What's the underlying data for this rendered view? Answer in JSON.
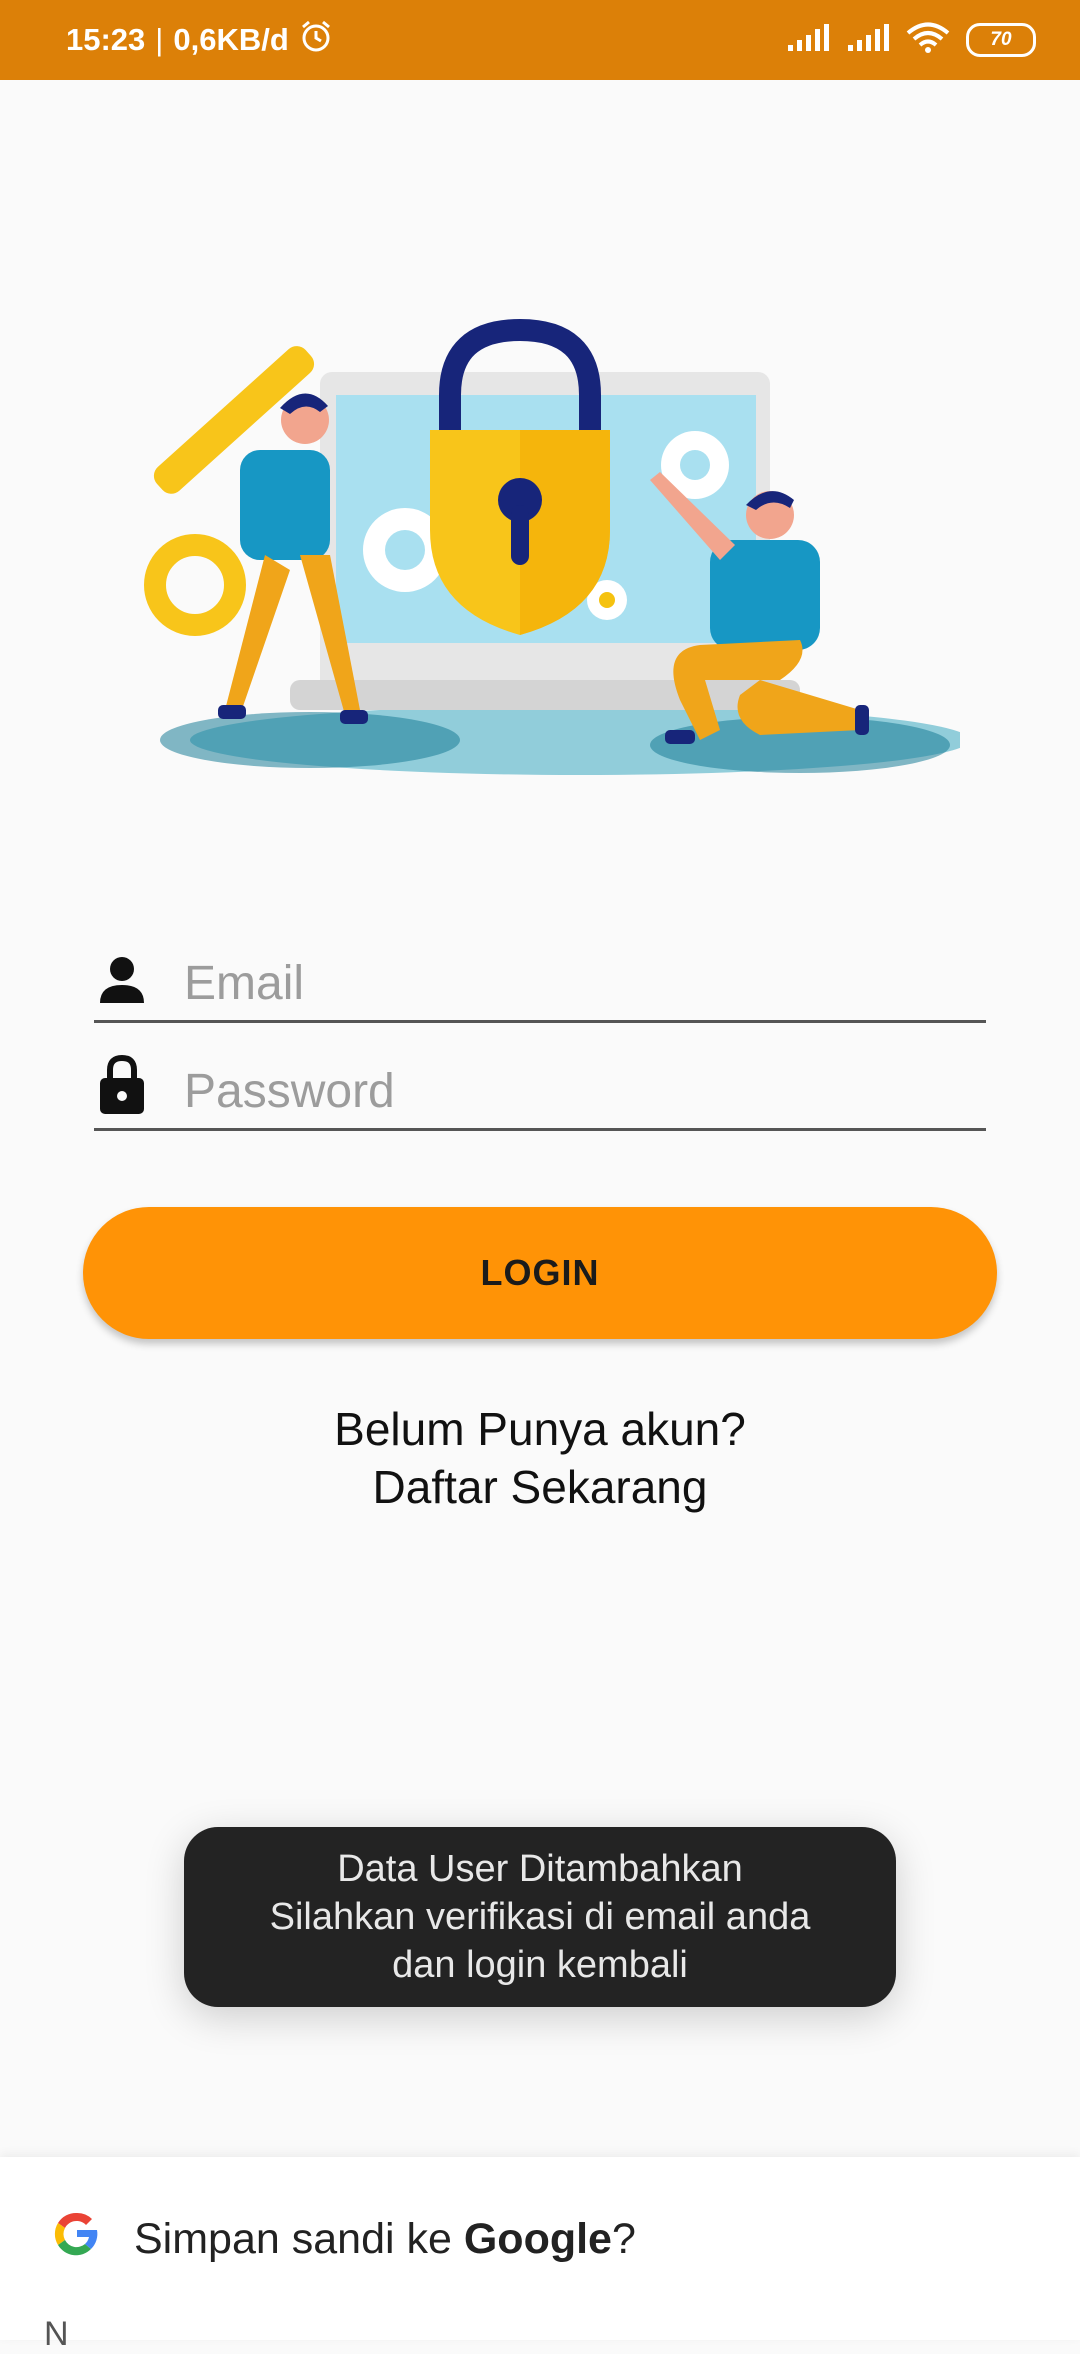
{
  "status_bar": {
    "time": "15:23",
    "separator": "|",
    "speed": "0,6KB/d",
    "battery": "70",
    "icons": [
      "alarm-icon",
      "signal-icon",
      "signal-icon",
      "wifi-icon",
      "battery-icon"
    ]
  },
  "illustration": {
    "name": "security-lock-illustration"
  },
  "form": {
    "email_placeholder": "Email",
    "password_placeholder": "Password",
    "login_label": "LOGIN",
    "register_line1": "Belum Punya akun?",
    "register_line2": "Daftar Sekarang"
  },
  "toast": {
    "line1": "Data User Ditambahkan",
    "line2": "Silahkan verifikasi di email anda",
    "line3": "dan login kembali"
  },
  "save_password": {
    "prefix": "Simpan sandi ke ",
    "brand": "Google",
    "suffix": "?",
    "sub": "N"
  },
  "colors": {
    "status_bar": "#dc8008",
    "button": "#ff9306",
    "toast_bg": "#232323"
  }
}
